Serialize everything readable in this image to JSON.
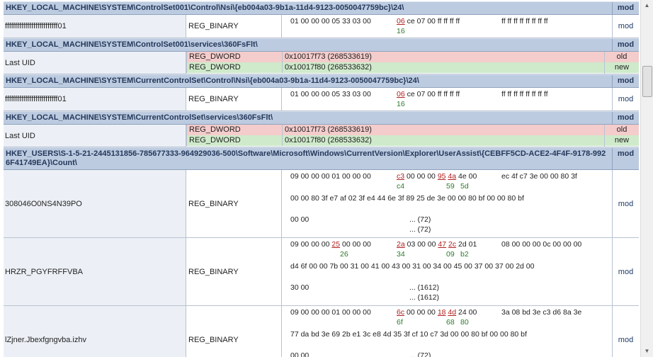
{
  "rows": [
    {
      "kind": "header",
      "key": "HKEY_LOCAL_MACHINE\\SYSTEM\\ControlSet001\\Control\\Nsi\\{eb004a03-9b1a-11d4-9123-0050047759bc}\\24\\",
      "status": "mod"
    },
    {
      "kind": "binary",
      "name": "ffffffffffffffffffffffffff01",
      "type": "REG_BINARY",
      "status": "mod",
      "hex": [
        "01  00  00  00  05  33  03  00",
        "06  ce  07  00  ff  ff  ff  ff",
        "ff  ff  ff  ff  ff  ff  ff  ff"
      ],
      "hex2": "16"
    },
    {
      "kind": "header",
      "key": "HKEY_LOCAL_MACHINE\\SYSTEM\\ControlSet001\\services\\360FsFlt\\",
      "status": "mod"
    },
    {
      "kind": "dword",
      "name": "Last UID",
      "old_type": "REG_DWORD",
      "old_val": "0x10017f73 (268533619)",
      "old_st": "old",
      "new_type": "REG_DWORD",
      "new_val": "0x10017f80 (268533632)",
      "new_st": "new"
    },
    {
      "kind": "header",
      "key": "HKEY_LOCAL_MACHINE\\SYSTEM\\CurrentControlSet\\Control\\Nsi\\{eb004a03-9b1a-11d4-9123-0050047759bc}\\24\\",
      "status": "mod"
    },
    {
      "kind": "binary",
      "name": "ffffffffffffffffffffffffff01",
      "type": "REG_BINARY",
      "status": "mod",
      "hex": [
        "01  00  00  00  05  33  03  00",
        "06  ce  07  00  ff  ff  ff  ff",
        "ff  ff  ff  ff  ff  ff  ff  ff"
      ],
      "hex2": "16"
    },
    {
      "kind": "header",
      "key": "HKEY_LOCAL_MACHINE\\SYSTEM\\CurrentControlSet\\services\\360FsFlt\\",
      "status": "mod"
    },
    {
      "kind": "dword",
      "name": "Last UID",
      "old_type": "REG_DWORD",
      "old_val": "0x10017f73 (268533619)",
      "old_st": "old",
      "new_type": "REG_DWORD",
      "new_val": "0x10017f80 (268533632)",
      "new_st": "new"
    },
    {
      "kind": "header2",
      "key": "HKEY_USERS\\S-1-5-21-2445131856-785677333-964929036-500\\Software\\Microsoft\\Windows\\CurrentVersion\\Explorer\\UserAssist\\{CEBFF5CD-ACE2-4F4F-9178-9926F41749EA}\\Count\\",
      "status": "mod"
    },
    {
      "kind": "long",
      "name": "308046O0NS4N39PO",
      "type": "REG_BINARY",
      "status": "mod",
      "l1a": "09  00  00  00  01  00  00  00",
      "l1b_r": "c3",
      "l1b": "  00  00  00  ",
      "l1b_r2": "95",
      "l1b_r3": "4a",
      "l1b_t": "  4e  00",
      "l1c": "ec  4f  c7  3e  00  00  80  3f",
      "l2_g1": "c4",
      "l2_g2": "59",
      "l2_g3": "5d",
      "l3": "00  00  80  3f  e7  af  02  3f     e4  44  6e  3f  89  25  de  3e     00  00  80  bf  00  00  80  bf",
      "l4": "00  00",
      "e1": "... (72)",
      "e2": "... (72)"
    },
    {
      "kind": "long",
      "name": "HRZR_PGYFRFFVBA",
      "type": "REG_BINARY",
      "status": "mod",
      "l1a_pre": "09  00  00  00  ",
      "l1a_r": "25",
      "l1a_post": "  00  00  00",
      "l1b_r": "2a",
      "l1b": "  03  00  00  ",
      "l1b_r2": "47",
      "l1b_r3": "2c",
      "l1b_t": "  2d  01",
      "l1c": "08  00  00  00  0c  00  00  00",
      "l2_a": "26",
      "l2_g1": "34",
      "l2_g2": "09",
      "l2_g3": "b2",
      "l3": "d4  6f  00  00  7b  00  31  00     41  00  43  00  31  00  34  00     45  00  37  00  37  00  2d  00",
      "l4": "30  00",
      "e1": "... (1612)",
      "e2": "... (1612)"
    },
    {
      "kind": "long",
      "name": "lZjner.Jbexfgngvba.izhv",
      "type": "REG_BINARY",
      "status": "mod",
      "l1a": "09  00  00  00  01  00  00  00",
      "l1b_r": "6c",
      "l1b": "  00  00  00  ",
      "l1b_r2": "18",
      "l1b_r3": "4d",
      "l1b_t": "  24  00",
      "l1c": "3a  08  bd  3e  c3  d6  8a  3e",
      "l2_g1": "6f",
      "l2_g2": "68",
      "l2_g3": "80",
      "l3": "77  da  bd  3e  69  2b  e1  3c     e8  4d  35  3f  cf  10  c7  3d     00  00  80  bf  00  00  80  bf",
      "l4": "00  00",
      "e1": "... (72)",
      "e2": ""
    }
  ],
  "scrollbar": {
    "up": "▲",
    "down": "▼"
  }
}
